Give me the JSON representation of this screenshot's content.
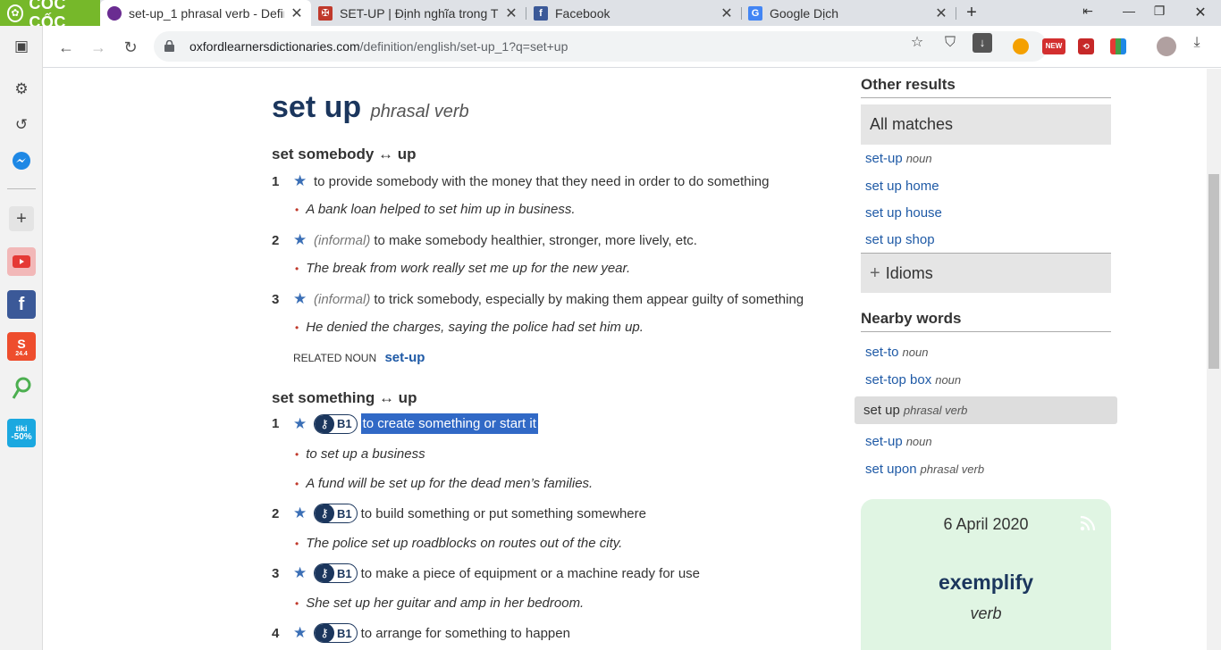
{
  "browser": {
    "brand": "CỐC CỐC",
    "tabs": [
      {
        "title": "set-up_1 phrasal verb - Defini",
        "active": true
      },
      {
        "title": "SET-UP | Định nghĩa trong Từ",
        "active": false
      },
      {
        "title": "Facebook",
        "active": false
      },
      {
        "title": "Google Dịch",
        "active": false
      }
    ],
    "url_host": "oxfordlearnersdictionaries.com",
    "url_path": "/definition/english/set-up_1?q=set+up",
    "ext_badge": "NEW"
  },
  "sidebar": {
    "shopee_badge": "24.4",
    "tiki_label": "tiki",
    "tiki_discount": "-50%"
  },
  "entry": {
    "headword": "set up",
    "pos": "phrasal verb",
    "groups": [
      {
        "phrase": "set somebody ↔ up",
        "senses": [
          {
            "num": "1",
            "label": "",
            "level": "",
            "def": "to provide somebody with the money that they need in order to do something",
            "examples": [
              "A bank loan helped to set him up in business."
            ]
          },
          {
            "num": "2",
            "label": "(informal)",
            "level": "",
            "def": "to make somebody healthier, stronger, more lively, etc.",
            "examples": [
              "The break from work really set me up for the new year."
            ]
          },
          {
            "num": "3",
            "label": "(informal)",
            "level": "",
            "def": "to trick somebody, especially by making them appear guilty of something",
            "examples": [
              "He denied the charges, saying the police had set him up."
            ]
          }
        ],
        "related_label": "RELATED NOUN",
        "related_link": "set-up"
      },
      {
        "phrase": "set something ↔ up",
        "senses": [
          {
            "num": "1",
            "label": "",
            "level": "B1",
            "def": "to create something or start it",
            "examples": [
              "to set up a business",
              "A fund will be set up for the dead men’s families."
            ]
          },
          {
            "num": "2",
            "label": "",
            "level": "B1",
            "def": "to build something or put something somewhere",
            "examples": [
              "The police set up roadblocks on routes out of the city."
            ]
          },
          {
            "num": "3",
            "label": "",
            "level": "B1",
            "def": "to make a piece of equipment or a machine ready for use",
            "examples": [
              "She set up her guitar and amp in her bedroom."
            ]
          },
          {
            "num": "4",
            "label": "",
            "level": "B1",
            "def": "to arrange for something to happen",
            "examples": []
          }
        ]
      }
    ]
  },
  "aside": {
    "other_results_title": "Other results",
    "all_matches": "All matches",
    "matches": [
      {
        "text": "set-up",
        "pos": "noun"
      },
      {
        "text": "set up home",
        "pos": ""
      },
      {
        "text": "set up house",
        "pos": ""
      },
      {
        "text": "set up shop",
        "pos": ""
      }
    ],
    "idioms_label": "Idioms",
    "nearby_title": "Nearby words",
    "nearby": [
      {
        "text": "set-to",
        "pos": "noun"
      },
      {
        "text": "set-top box",
        "pos": "noun"
      },
      {
        "text": "set up",
        "pos": "phrasal verb",
        "selected": true
      },
      {
        "text": "set-up",
        "pos": "noun"
      },
      {
        "text": "set upon",
        "pos": "phrasal verb"
      }
    ],
    "wotd": {
      "date": "6 April 2020",
      "word": "exemplify",
      "pos": "verb"
    }
  }
}
